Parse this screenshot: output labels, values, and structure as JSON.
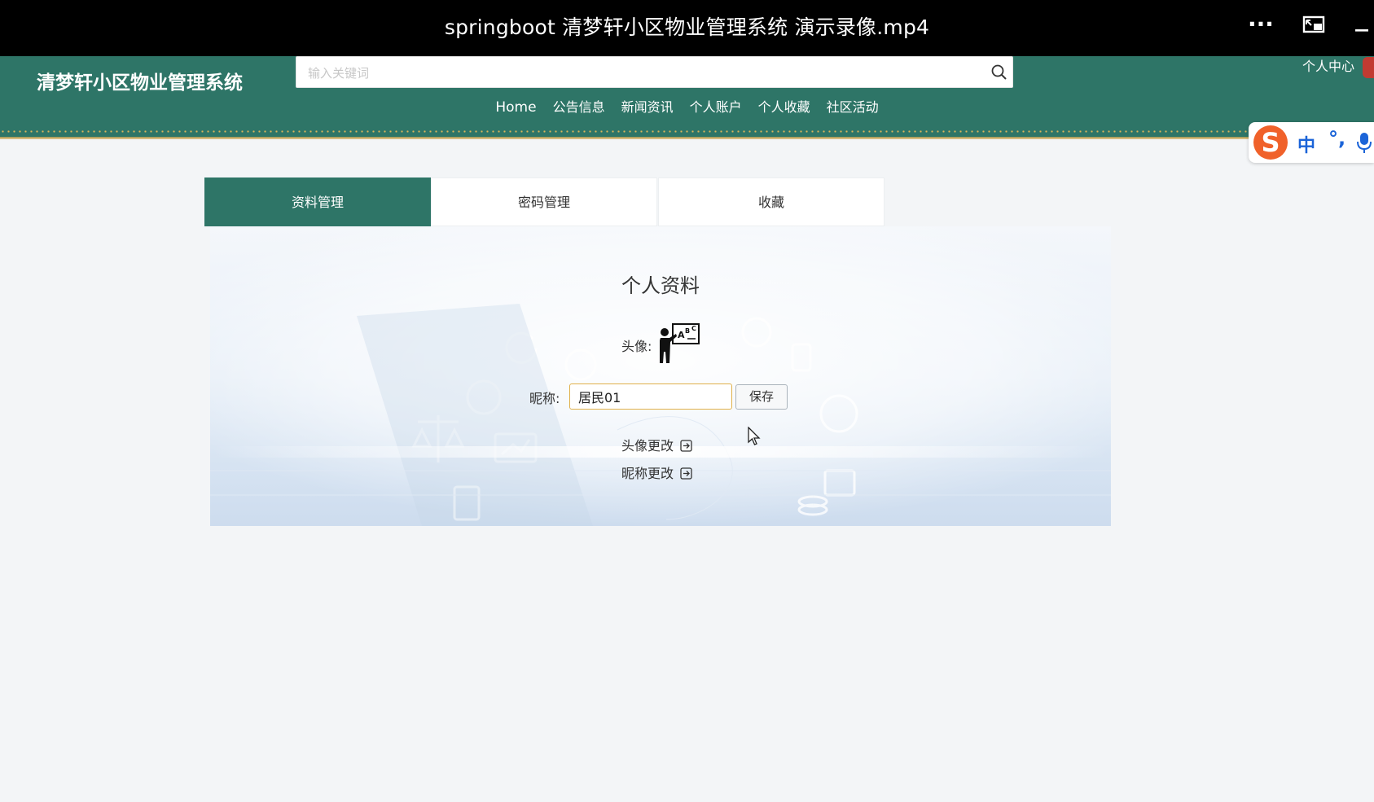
{
  "player": {
    "title": "springboot 清梦轩小区物业管理系统 演示录像.mp4",
    "more_icon": "ellipsis-icon",
    "pip_icon": "picture-in-picture-icon",
    "minimize_icon": "minimize-icon"
  },
  "header": {
    "site_title": "清梦轩小区物业管理系统",
    "search_placeholder": "输入关键词",
    "search_icon": "search-icon",
    "user_center": "个人中心",
    "nav": [
      "Home",
      "公告信息",
      "新闻资讯",
      "个人账户",
      "个人收藏",
      "社区活动"
    ],
    "accent_color": "#2e7567"
  },
  "ime": {
    "logo": "S",
    "mode": "中",
    "punct": "°,",
    "mic_icon": "microphone-icon"
  },
  "tabs": [
    {
      "label": "资料管理",
      "active": true
    },
    {
      "label": "密码管理",
      "active": false
    },
    {
      "label": "收藏",
      "active": false
    }
  ],
  "profile": {
    "title": "个人资料",
    "avatar_label": "头像:",
    "avatar_icon": "teacher-at-board-icon",
    "nickname_label": "昵称:",
    "nickname_value": "居民01",
    "save_label": "保存",
    "change_avatar": "头像更改",
    "change_nickname": "昵称更改",
    "link_icon": "external-link-icon"
  }
}
